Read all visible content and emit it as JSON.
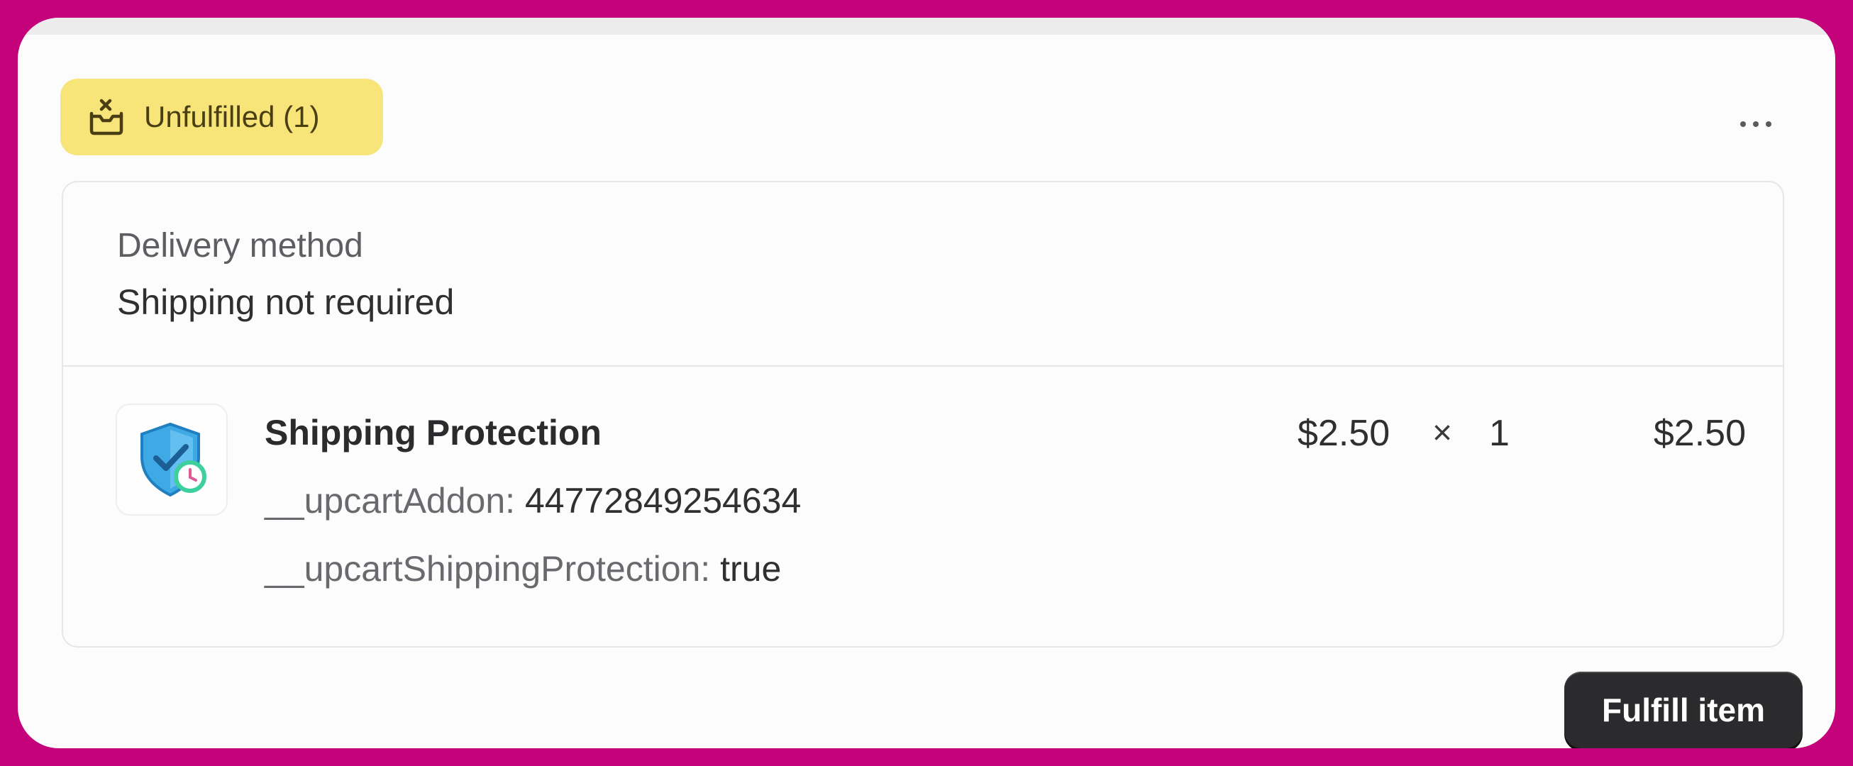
{
  "fulfillment": {
    "status_badge": {
      "label": "Unfulfilled (1)",
      "icon": "package-unfulfilled-icon",
      "color": "#f7e57a"
    },
    "more_actions_icon": "ellipsis-icon",
    "delivery": {
      "label": "Delivery method",
      "value": "Shipping not required"
    },
    "line_item": {
      "thumbnail_icon": "shield-check-clock-icon",
      "name": "Shipping Protection",
      "properties": [
        {
          "key": "__upcartAddon:",
          "value": "44772849254634"
        },
        {
          "key": "__upcartShippingProtection:",
          "value": "true"
        }
      ],
      "unit_price": "$2.50",
      "times_symbol": "×",
      "quantity": "1",
      "total": "$2.50"
    },
    "fulfill_button_label": "Fulfill item"
  }
}
